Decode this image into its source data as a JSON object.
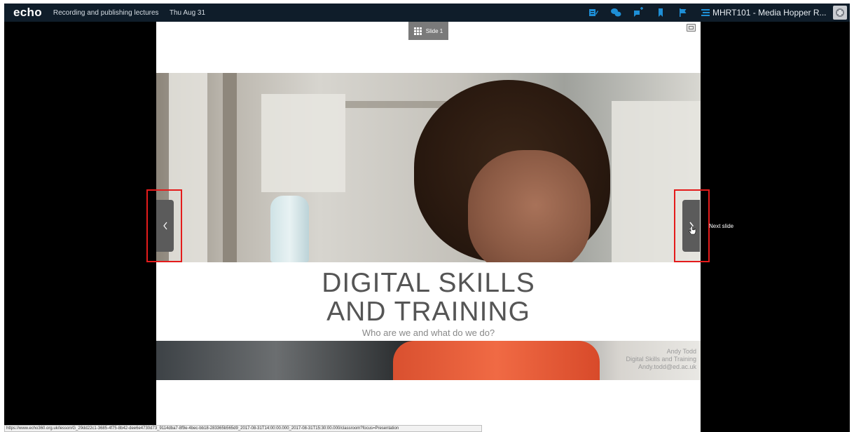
{
  "header": {
    "logo": "echo",
    "lecture_title": "Recording and publishing lectures",
    "lecture_date": "Thu Aug 31",
    "course_title": "MHRT101 - Media Hopper R...",
    "tools": [
      {
        "name": "notes-icon"
      },
      {
        "name": "discussion-icon"
      },
      {
        "name": "question-icon"
      },
      {
        "name": "bookmark-icon"
      },
      {
        "name": "flag-icon"
      },
      {
        "name": "list-icon"
      }
    ]
  },
  "slide": {
    "tab_label": "Slide 1",
    "title_line1": "DIGITAL SKILLS",
    "title_line2": "AND TRAINING",
    "subtitle": "Who are we and what do we do?",
    "presenter": {
      "name": "Andy Todd",
      "team": "Digital Skills and Training",
      "email": "Andy.todd@ed.ac.uk"
    }
  },
  "navigation": {
    "prev_glyph": "‹",
    "next_glyph": "›",
    "next_tooltip": "Next slide"
  },
  "status_url": "https://www.echo360.org.uk/lesson/G_29dd22c1-3685-4f75-8b42-dee6e4730d73_9114dba7-8f9e-4bec-bb18-283365b565d9_2017-08-31T14:00:00.000_2017-08-31T15:30:00.000/classroom?focus=Presentation",
  "colors": {
    "accent": "#1e8fd6",
    "header_bg": "#0f1d2a",
    "highlight": "#e41b1b"
  }
}
